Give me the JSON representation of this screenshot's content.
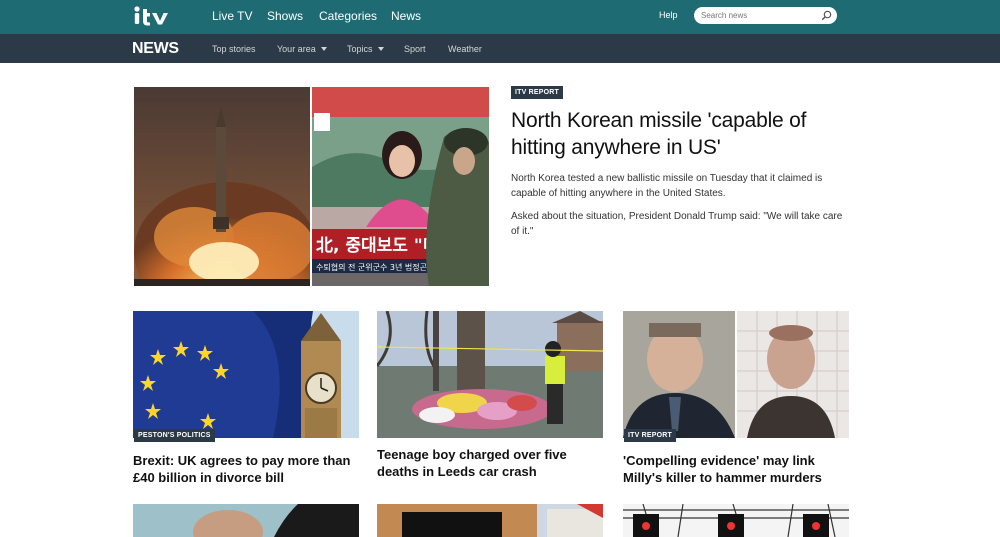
{
  "nav": {
    "items": [
      {
        "label": "Live TV"
      },
      {
        "label": "Shows"
      },
      {
        "label": "Categories"
      },
      {
        "label": "News"
      }
    ],
    "help": "Help",
    "search_placeholder": "Search news"
  },
  "subnav": {
    "title": "NEWS",
    "items": [
      {
        "label": "Top stories"
      },
      {
        "label": "Your area"
      },
      {
        "label": "Topics"
      },
      {
        "label": "Sport"
      },
      {
        "label": "Weather"
      }
    ]
  },
  "lead": {
    "tag": "ITV REPORT",
    "headline": "North Korean missile 'capable of hitting anywhere in US'",
    "p1": "North Korea tested a new ballistic missile on Tuesday that it claimed is capable of hitting anywhere in the United States.",
    "p2": "Asked about the situation, President Donald Trump said: \"We will take care of it.\"",
    "tv_banner": "北, 중대보도 \"미사일",
    "tv_ticker": "수퇴협의 전 군위군수 3년 법정곤"
  },
  "cards": [
    {
      "tag": "PESTON'S POLITICS",
      "headline": "Brexit: UK agrees to pay more than £40 billion in divorce bill"
    },
    {
      "tag": "",
      "headline": "Teenage boy charged over five deaths in Leeds car crash"
    },
    {
      "tag": "ITV REPORT",
      "headline": "'Compelling evidence' may link Milly's killer to hammer murders"
    }
  ],
  "colors": {
    "topbar": "#1f6b74",
    "subbar": "#2c3a47"
  }
}
